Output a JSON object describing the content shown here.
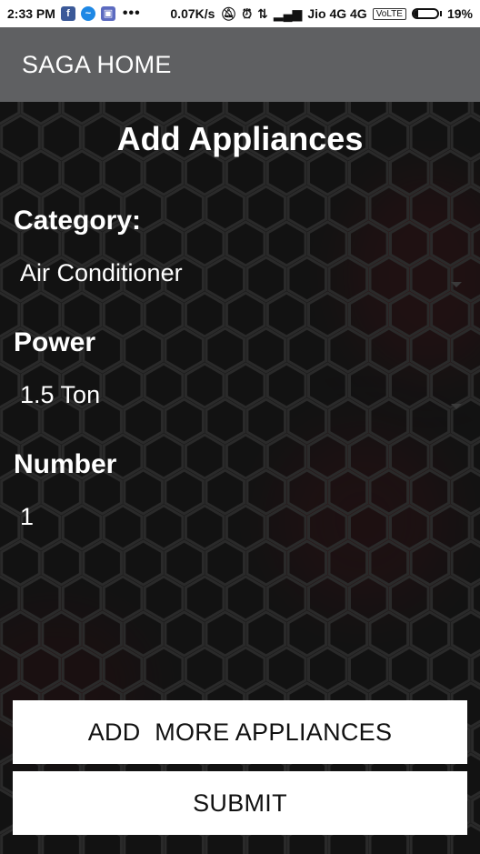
{
  "status_bar": {
    "time": "2:33 PM",
    "notification_icons": [
      "facebook-icon",
      "messenger-icon",
      "gallery-icon"
    ],
    "more_dots": "•••",
    "speed": "0.07K/s",
    "carrier": "Jio 4G 4G",
    "volte": "VoLTE",
    "battery_percent": "19%",
    "battery_level": 0.19
  },
  "app_bar": {
    "title": "SAGA HOME",
    "color": "#5f6062"
  },
  "form": {
    "heading": "Add Appliances",
    "category": {
      "label": "Category:",
      "value": "Air Conditioner"
    },
    "power": {
      "label": "Power",
      "value": "1.5 Ton"
    },
    "number": {
      "label": "Number",
      "value": "1"
    }
  },
  "buttons": {
    "add_more": "ADD  MORE APPLIANCES",
    "submit": "SUBMIT"
  },
  "colors": {
    "background": "#151515",
    "hex_stroke": "#2a2a2a",
    "glow": "#6a0f16"
  }
}
